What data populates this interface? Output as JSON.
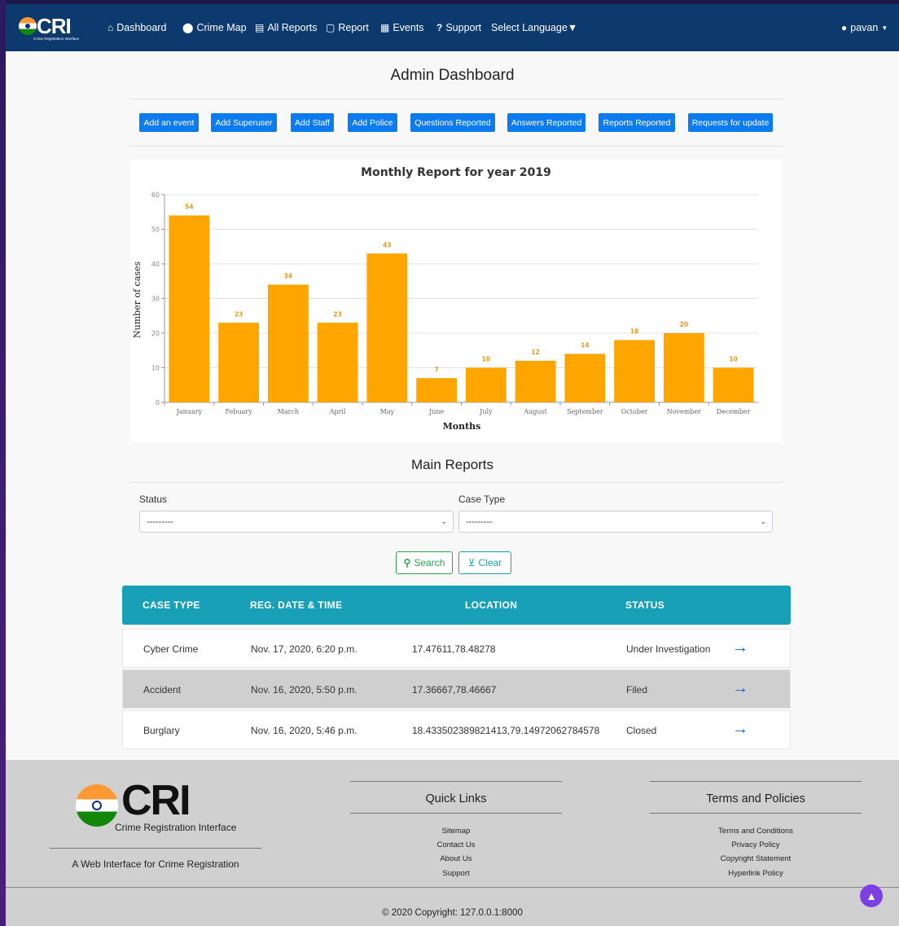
{
  "navbar": {
    "brand": "CRI",
    "brand_sub": "Crime Registration Interface",
    "items": [
      {
        "label": "Dashboard",
        "icon": "home-icon"
      },
      {
        "label": "Crime Map",
        "icon": "map-marker-icon"
      },
      {
        "label": "All Reports",
        "icon": "document-icon"
      },
      {
        "label": "Report",
        "icon": "clipboard-icon"
      },
      {
        "label": "Events",
        "icon": "calendar-icon"
      },
      {
        "label": "Support",
        "icon": "question-icon"
      },
      {
        "label": "Select Language▼",
        "icon": ""
      }
    ],
    "user": "pavan"
  },
  "page_title": "Admin Dashboard",
  "actions": [
    "Add an event",
    "Add Superuser",
    "Add Staff",
    "Add Police",
    "Questions Reported",
    "Answers Reported",
    "Reports Reported",
    "Requests for update"
  ],
  "chart_data": {
    "type": "bar",
    "title": "Monthly Report for year 2019",
    "xlabel": "Months",
    "ylabel": "Number of cases",
    "categories": [
      "January",
      "Febuary",
      "March",
      "April",
      "May",
      "June",
      "July",
      "August",
      "September",
      "October",
      "November",
      "December"
    ],
    "values": [
      54,
      23,
      34,
      23,
      43,
      7,
      10,
      12,
      14,
      18,
      20,
      10
    ],
    "ylim": [
      0,
      60
    ],
    "yticks": [
      0,
      10,
      20,
      30,
      40,
      50,
      60
    ],
    "grid": true,
    "color": "#ffa500",
    "label_color": "#e39a1c"
  },
  "main_reports": {
    "title": "Main Reports",
    "status_label": "Status",
    "status_value": "---------",
    "case_type_label": "Case Type",
    "case_type_value": "---------",
    "search_label": "Search",
    "clear_label": "Clear"
  },
  "table": {
    "headers": [
      "CASE TYPE",
      "REG. DATE & TIME",
      "LOCATION",
      "STATUS"
    ],
    "rows": [
      {
        "case_type": "Cyber Crime",
        "date": "Nov. 17, 2020, 6:20 p.m.",
        "location": "17.47611,78.48278",
        "status": "Under Investigation"
      },
      {
        "case_type": "Accident",
        "date": "Nov. 16, 2020, 5:50 p.m.",
        "location": "17.36667,78.46667",
        "status": "Filed"
      },
      {
        "case_type": "Burglary",
        "date": "Nov. 16, 2020, 5:46 p.m.",
        "location": "18.433502389821413,79.14972062784578",
        "status": "Closed"
      }
    ]
  },
  "footer": {
    "logo": "CRI",
    "logo_sub": "Crime Registration Interface",
    "tagline": "A Web Interface for Crime Registration",
    "quick_links_title": "Quick Links",
    "quick_links": [
      "Sitemap",
      "Contact Us",
      "About Us",
      "Support"
    ],
    "terms_title": "Terms and Policies",
    "terms_links": [
      "Terms and Conditions",
      "Privacy Policy",
      "Copyright Statement",
      "Hyperlink Policy"
    ],
    "copyright": "© 2020 Copyright:  127.0.0.1:8000"
  }
}
